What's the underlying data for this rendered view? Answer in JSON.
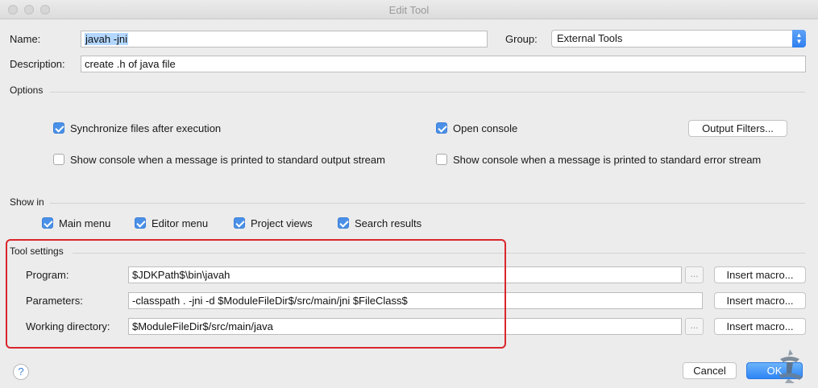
{
  "window": {
    "title": "Edit Tool"
  },
  "name": {
    "label": "Name:",
    "value": "javah -jni"
  },
  "group": {
    "label": "Group:",
    "value": "External Tools"
  },
  "description": {
    "label": "Description:",
    "value": "create .h of java file"
  },
  "options": {
    "title": "Options",
    "sync_files": {
      "label": "Synchronize files after execution",
      "checked": true
    },
    "open_console": {
      "label": "Open console",
      "checked": true
    },
    "output_filters_label": "Output Filters...",
    "console_stdout": {
      "label": "Show console when a message is printed to standard output stream",
      "checked": false
    },
    "console_stderr": {
      "label": "Show console when a message is printed to standard error stream",
      "checked": false
    }
  },
  "show_in": {
    "title": "Show in",
    "main_menu": {
      "label": "Main menu",
      "checked": true
    },
    "editor_menu": {
      "label": "Editor menu",
      "checked": true
    },
    "project_views": {
      "label": "Project views",
      "checked": true
    },
    "search_results": {
      "label": "Search results",
      "checked": true
    }
  },
  "tool_settings": {
    "title": "Tool settings",
    "program": {
      "label": "Program:",
      "value": "$JDKPath$\\bin\\javah"
    },
    "parameters": {
      "label": "Parameters:",
      "value": "-classpath . -jni -d $ModuleFileDir$/src/main/jni $FileClass$"
    },
    "working_directory": {
      "label": "Working directory:",
      "value": "$ModuleFileDir$/src/main/java"
    },
    "browse_label": "...",
    "insert_macro_label": "Insert macro..."
  },
  "footer": {
    "help_label": "?",
    "cancel_label": "Cancel",
    "ok_label": "OK"
  },
  "colors": {
    "accent": "#2d85f5",
    "highlight_box": "#d9262c"
  }
}
